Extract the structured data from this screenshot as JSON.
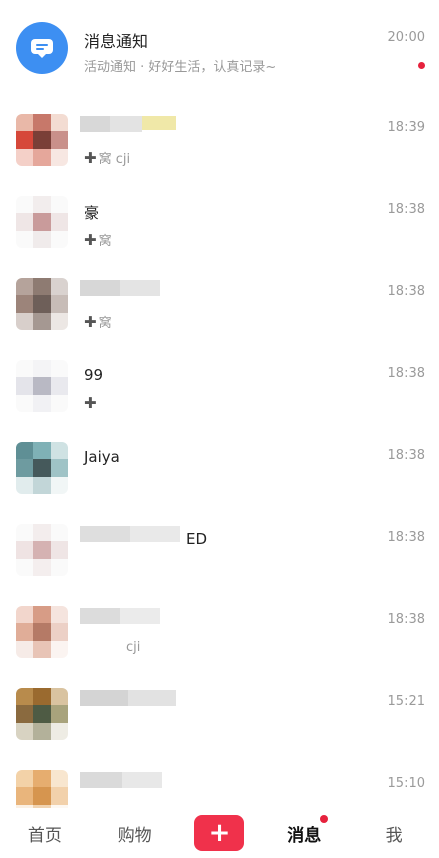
{
  "messages": [
    {
      "name": "消息通知",
      "preview": "活动通知 · 好好生活，认真记录~",
      "time": "20:00",
      "unread": true
    },
    {
      "name": "",
      "preview": "窝 cji",
      "time": "18:39"
    },
    {
      "name": "豪",
      "preview": "窝",
      "time": "18:38"
    },
    {
      "name": "",
      "preview": "窝",
      "time": "18:38"
    },
    {
      "name": "99",
      "preview": "",
      "time": "18:38"
    },
    {
      "name": "Jaiya",
      "preview": "",
      "time": "18:38"
    },
    {
      "name": "ED",
      "preview": "",
      "time": "18:38"
    },
    {
      "name": "",
      "preview": "cji",
      "time": "18:38"
    },
    {
      "name": "",
      "preview": "",
      "time": "15:21"
    },
    {
      "name": "",
      "preview": "",
      "time": "15:10"
    }
  ],
  "tabbar": {
    "home": "首页",
    "shop": "购物",
    "publish": "+",
    "messages": "消息",
    "me": "我"
  },
  "icons": {
    "system_avatar": "message-bubble-icon",
    "add_friend": "plus-icon"
  },
  "colors": {
    "accent": "#f0314b",
    "system_avatar": "#3d8ff2",
    "unread_dot": "#e6223d"
  }
}
